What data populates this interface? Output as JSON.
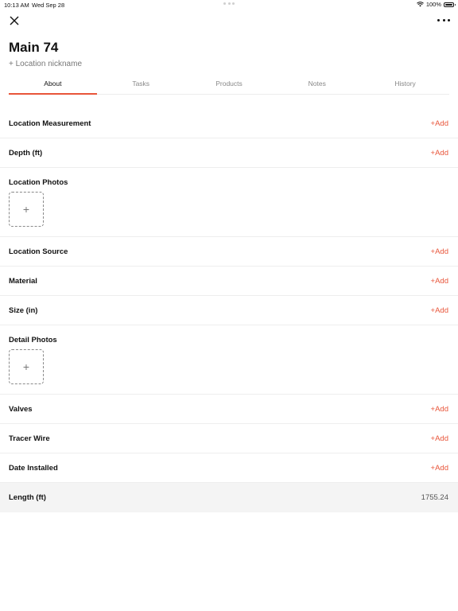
{
  "status_bar": {
    "time": "10:13 AM",
    "date": "Wed Sep 28",
    "battery": "100%"
  },
  "header": {
    "title": "Main 74",
    "nickname_link": "+ Location nickname"
  },
  "tabs": [
    {
      "label": "About",
      "active": true
    },
    {
      "label": "Tasks",
      "active": false
    },
    {
      "label": "Products",
      "active": false
    },
    {
      "label": "Notes",
      "active": false
    },
    {
      "label": "History",
      "active": false
    }
  ],
  "rows": [
    {
      "label": "Location Measurement",
      "action": "+Add"
    },
    {
      "label": "Depth (ft)",
      "action": "+Add"
    },
    {
      "label": "Location Photos",
      "add_symbol": "+"
    },
    {
      "label": "Location Source",
      "action": "+Add"
    },
    {
      "label": "Material",
      "action": "+Add"
    },
    {
      "label": "Size (in)",
      "action": "+Add"
    },
    {
      "label": "Detail Photos",
      "add_symbol": "+"
    },
    {
      "label": "Valves",
      "action": "+Add"
    },
    {
      "label": "Tracer Wire",
      "action": "+Add"
    },
    {
      "label": "Date Installed",
      "action": "+Add"
    },
    {
      "label": "Length (ft)",
      "value": "1755.24"
    }
  ],
  "colors": {
    "accent": "#e8553a",
    "highlight_row": "#f4f4f4"
  },
  "icons": {
    "close": "close-icon",
    "more": "more-icon",
    "wifi": "wifi-icon",
    "battery": "battery-icon",
    "add_photo": "plus-icon"
  }
}
